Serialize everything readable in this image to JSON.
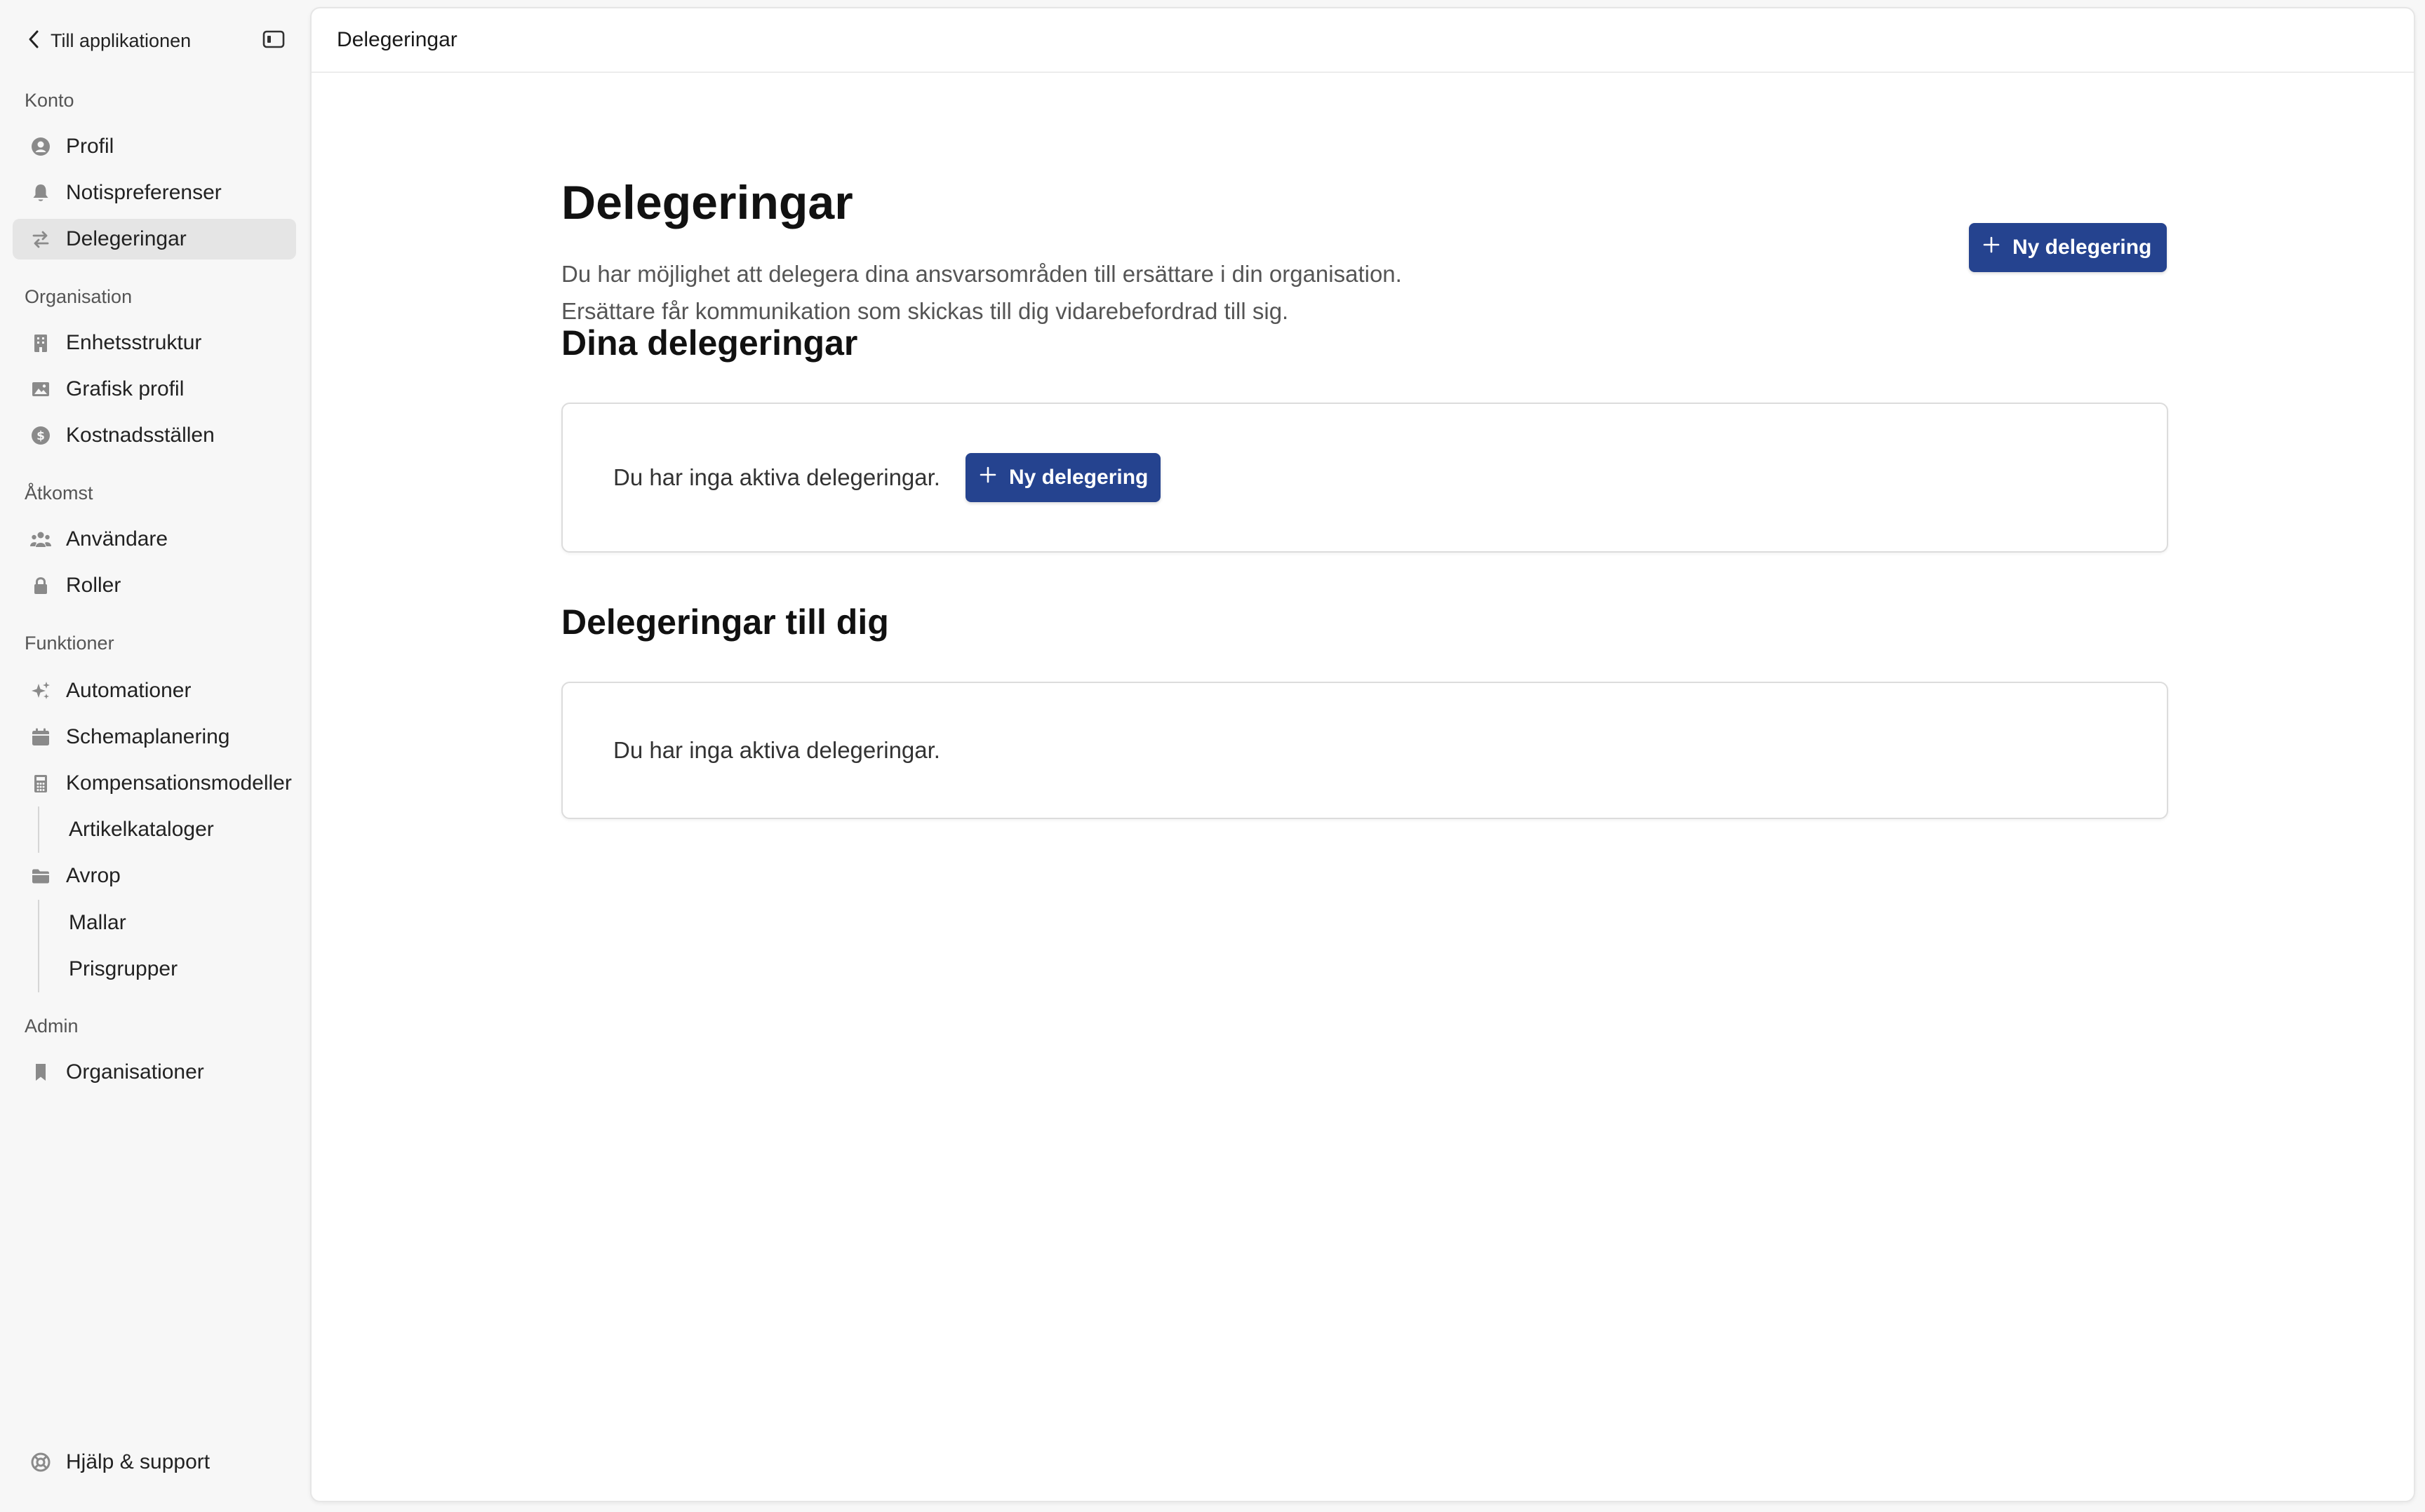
{
  "sidebar": {
    "back_label": "Till applikationen",
    "sections": {
      "konto": "Konto",
      "organisation": "Organisation",
      "atkomst": "Åtkomst",
      "funktioner": "Funktioner",
      "admin": "Admin"
    },
    "items": {
      "profil": "Profil",
      "notispreferenser": "Notispreferenser",
      "delegeringar": "Delegeringar",
      "enhetsstruktur": "Enhetsstruktur",
      "grafisk_profil": "Grafisk profil",
      "kostnadsstallen": "Kostnadsställen",
      "anvandare": "Användare",
      "roller": "Roller",
      "automationer": "Automationer",
      "schemaplanering": "Schemaplanering",
      "kompensationsmodeller": "Kompensationsmodeller",
      "artikelkataloger": "Artikelkataloger",
      "avrop": "Avrop",
      "mallar": "Mallar",
      "prisgrupper": "Prisgrupper",
      "organisationer": "Organisationer"
    },
    "active_item": "delegeringar",
    "help_label": "Hjälp & support"
  },
  "topbar": {
    "breadcrumb": "Delegeringar"
  },
  "main": {
    "title": "Delegeringar",
    "description_line1": "Du har möjlighet att delegera dina ansvarsområden till ersättare i din organisation.",
    "description_line2": "Ersättare får kommunikation som skickas till dig vidarebefordrad till sig.",
    "new_button_label": "Ny delegering",
    "your_delegations": {
      "heading": "Dina delegeringar",
      "empty_text": "Du har inga aktiva delegeringar.",
      "button_label": "Ny delegering"
    },
    "delegations_to_you": {
      "heading": "Delegeringar till dig",
      "empty_text": "Du har inga aktiva delegeringar."
    }
  },
  "colors": {
    "primary": "#25438f",
    "sidebar_bg": "#f7f7f7",
    "active_item_bg": "#e5e5e5",
    "icon_gray": "#8a8a8a"
  }
}
